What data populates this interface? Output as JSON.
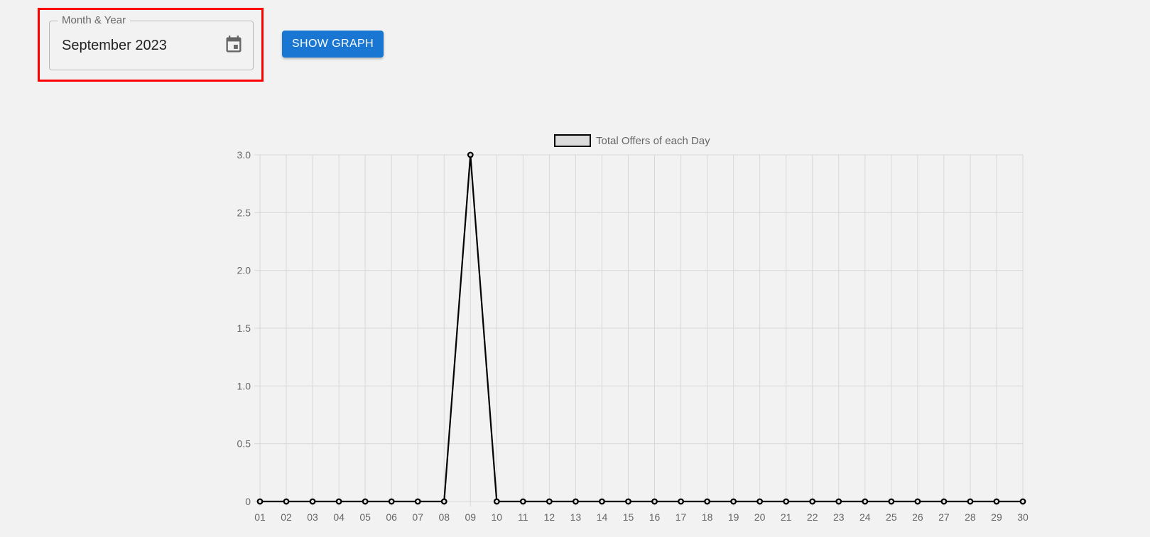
{
  "form": {
    "field_label": "Month & Year",
    "field_value": "September 2023",
    "calendar_icon": "calendar-icon",
    "show_button_label": "SHOW GRAPH",
    "accent_color": "#1976d2",
    "highlight_color": "#ff0000"
  },
  "chart_data": {
    "type": "line",
    "categories": [
      "01",
      "02",
      "03",
      "04",
      "05",
      "06",
      "07",
      "08",
      "09",
      "10",
      "11",
      "12",
      "13",
      "14",
      "15",
      "16",
      "17",
      "18",
      "19",
      "20",
      "21",
      "22",
      "23",
      "24",
      "25",
      "26",
      "27",
      "28",
      "29",
      "30"
    ],
    "series": [
      {
        "name": "Total Offers of each Day",
        "values": [
          0,
          0,
          0,
          0,
          0,
          0,
          0,
          0,
          3,
          0,
          0,
          0,
          0,
          0,
          0,
          0,
          0,
          0,
          0,
          0,
          0,
          0,
          0,
          0,
          0,
          0,
          0,
          0,
          0,
          0
        ],
        "color": "#000000"
      }
    ],
    "ylim": [
      0,
      3
    ],
    "yticks": [
      "0",
      "0.5",
      "1.0",
      "1.5",
      "2.0",
      "2.5",
      "3.0"
    ],
    "grid": true,
    "legend": "top-center"
  }
}
